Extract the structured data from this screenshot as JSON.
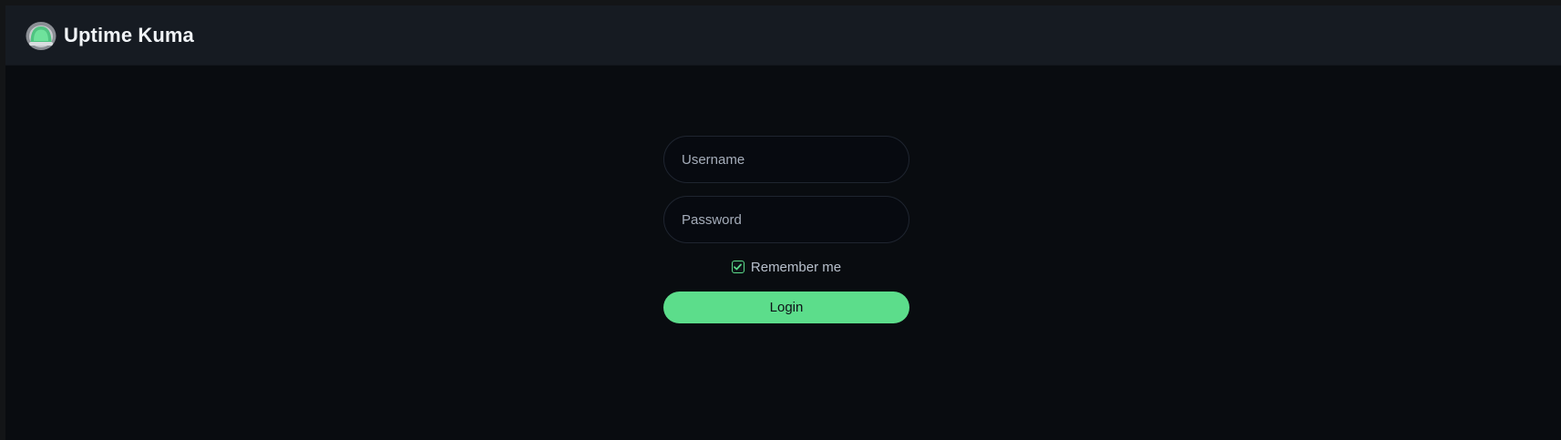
{
  "header": {
    "title": "Uptime Kuma",
    "logo_icon": "uptime-kuma-logo-icon"
  },
  "login_form": {
    "username": {
      "placeholder": "Username",
      "value": ""
    },
    "password": {
      "placeholder": "Password",
      "value": ""
    },
    "remember_me": {
      "label": "Remember me",
      "checked": true
    },
    "submit_label": "Login"
  },
  "colors": {
    "accent": "#5cdd8b",
    "background": "#090c10",
    "header_background": "#161b22"
  }
}
